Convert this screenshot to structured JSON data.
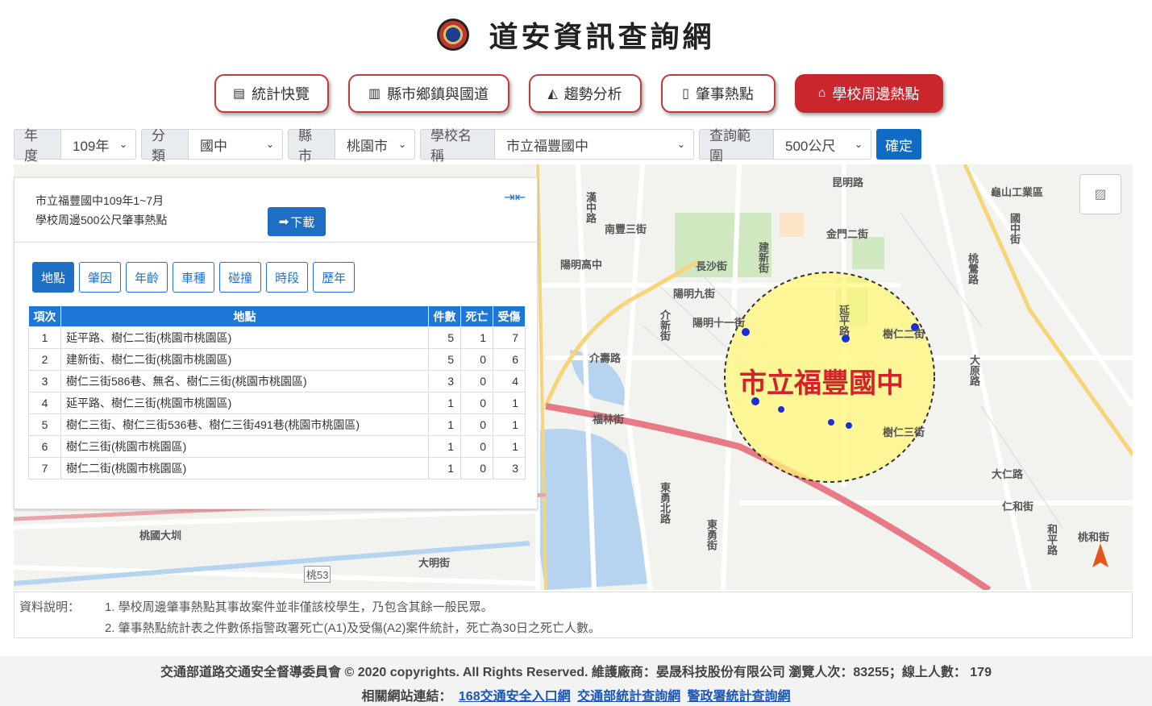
{
  "header": {
    "title": "道安資訊查詢網"
  },
  "nav": [
    {
      "label": "統計快覽",
      "icon": "newspaper-icon"
    },
    {
      "label": "縣市鄉鎮與國道",
      "icon": "bar-chart-icon"
    },
    {
      "label": "趨勢分析",
      "icon": "area-chart-icon"
    },
    {
      "label": "肇事熱點",
      "icon": "map-icon"
    },
    {
      "label": "學校周邊熱點",
      "icon": "school-icon",
      "active": true
    }
  ],
  "filters": {
    "year": {
      "label": "年度",
      "value": "109年"
    },
    "category": {
      "label": "分類",
      "value": "國中"
    },
    "city": {
      "label": "縣市",
      "value": "桃園市"
    },
    "school": {
      "label": "學校名稱",
      "value": "市立福豐國中"
    },
    "range": {
      "label": "查詢範圍",
      "value": "500公尺"
    },
    "confirm_label": "確定"
  },
  "map": {
    "school_label": "市立福豐國中",
    "labels": [
      "昆明路",
      "金門二街",
      "龜山工業區",
      "南豐三街",
      "陽明高中",
      "長沙街",
      "陽明九街",
      "陽明十一街",
      "介壽路",
      "介新街",
      "福林街",
      "樹仁二街",
      "樹仁三街",
      "大仁路",
      "仁和街",
      "桃和街",
      "和平路",
      "東勇北路",
      "東勇街",
      "大原路",
      "桃國大圳",
      "大明街",
      "桃53",
      "延平路",
      "建新街",
      "漢中路",
      "國中街",
      "桃鶯路"
    ]
  },
  "panel": {
    "line1": "市立福豐國中109年1~7月",
    "line2": "學校周邊500公尺肇事熱點",
    "download_label": "下載",
    "tabs": [
      "地點",
      "肇因",
      "年齡",
      "車種",
      "碰撞",
      "時段",
      "歷年"
    ],
    "columns": [
      "項次",
      "地點",
      "件數",
      "死亡",
      "受傷"
    ],
    "rows": [
      [
        "1",
        "延平路、樹仁二街(桃園市桃園區)",
        "5",
        "1",
        "7"
      ],
      [
        "2",
        "建新街、樹仁二街(桃園市桃園區)",
        "5",
        "0",
        "6"
      ],
      [
        "3",
        "樹仁三街586巷、無名、樹仁三街(桃園市桃園區)",
        "3",
        "0",
        "4"
      ],
      [
        "4",
        "延平路、樹仁三街(桃園市桃園區)",
        "1",
        "0",
        "1"
      ],
      [
        "5",
        "樹仁三街、樹仁三街536巷、樹仁三街491巷(桃園市桃園區)",
        "1",
        "0",
        "1"
      ],
      [
        "6",
        "樹仁三街(桃園市桃園區)",
        "1",
        "0",
        "1"
      ],
      [
        "7",
        "樹仁二街(桃園市桃園區)",
        "1",
        "0",
        "3"
      ]
    ]
  },
  "info": {
    "label": "資料說明：",
    "line1": "1. 學校周邊肇事熱點其事故案件並非僅該校學生，乃包含其餘一般民眾。",
    "line2": "2. 肇事熱點統計表之件數係指警政署死亡(A1)及受傷(A2)案件統計，死亡為30日之死亡人數。"
  },
  "footer": {
    "line1": "交通部道路交通安全督導委員會 © 2020 copyrights. All Rights Reserved. 維護廠商：晏晟科技股份有限公司 瀏覽人次：83255；線上人數： 179",
    "links_label": "相關網站連結：",
    "links": [
      "168交通安全入口網",
      "交通部統計查詢網",
      "警政署統計查詢網"
    ]
  }
}
